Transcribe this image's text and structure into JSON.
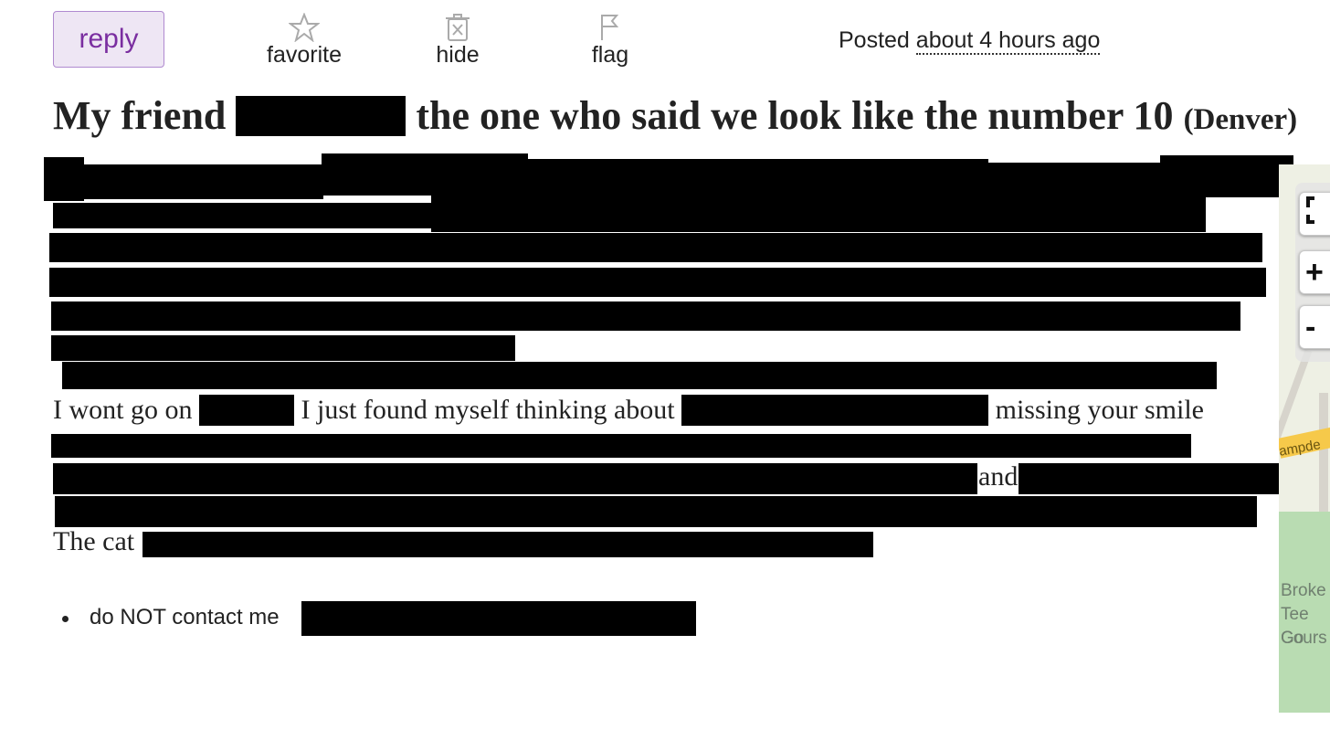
{
  "actions": {
    "reply": "reply",
    "favorite": "favorite",
    "hide": "hide",
    "flag": "flag"
  },
  "posted": {
    "prefix": "Posted",
    "ago": "about 4 hours ago"
  },
  "title": {
    "start": "My friend",
    "rest": "the one who said we look like the number 10",
    "location": "(Denver)"
  },
  "body": {
    "line1_a": "I wont go on",
    "line1_b": "I just found myself thinking about",
    "line1_c": "missing your smile",
    "line2_and": "and",
    "line3_start": "The cat"
  },
  "bullets": {
    "contact": "do NOT contact me"
  },
  "map": {
    "road_label": "ampde",
    "place_lines": [
      "Broke",
      "Tee Go",
      "Cours"
    ],
    "controls": [
      "fullscreen",
      "+",
      "-"
    ]
  },
  "colors": {
    "reply_bg": "#eee6f4",
    "reply_text": "#7a2ea0",
    "redaction": "#000000"
  }
}
